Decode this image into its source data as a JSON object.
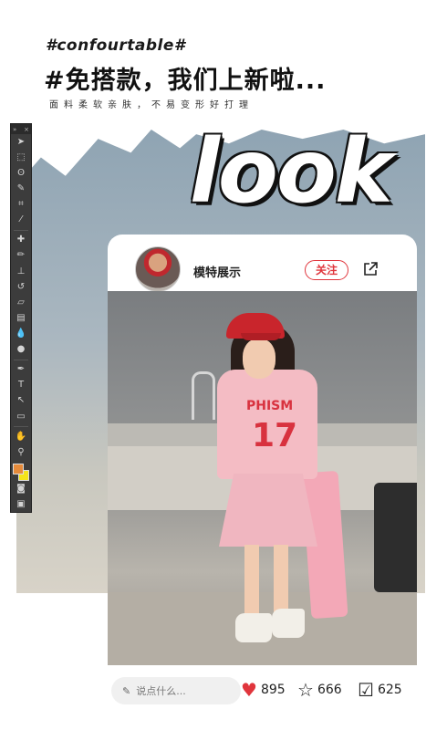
{
  "header": {
    "hashtag": "#confourtable#",
    "headline": "#免搭款，我们上新啦...",
    "subline": "面料柔软亲肤，不易变形好打理"
  },
  "hero_text": "look",
  "toolbar": {
    "collapse_label": "»",
    "close_label": "×",
    "tools": [
      "move-tool",
      "marquee-tool",
      "lasso-tool",
      "quick-select-tool",
      "crop-tool",
      "eyedropper-tool",
      "healing-brush-tool",
      "brush-tool",
      "clone-stamp-tool",
      "history-brush-tool",
      "eraser-tool",
      "gradient-tool",
      "blur-tool",
      "dodge-tool",
      "pen-tool",
      "type-tool",
      "path-select-tool",
      "shape-tool",
      "hand-tool",
      "zoom-tool"
    ],
    "foreground_color": "#e58a3a",
    "background_color": "#f4e41a"
  },
  "profile": {
    "username": "模特展示",
    "follow_label": "关注"
  },
  "photo_text": {
    "shirt_brand": "PHISM",
    "shirt_number": "17"
  },
  "bottom": {
    "comment_placeholder": "说点什么...",
    "likes": "895",
    "stars": "666",
    "checks": "625"
  },
  "colors": {
    "accent_red": "#e0353c",
    "like_red": "#e0353c"
  }
}
